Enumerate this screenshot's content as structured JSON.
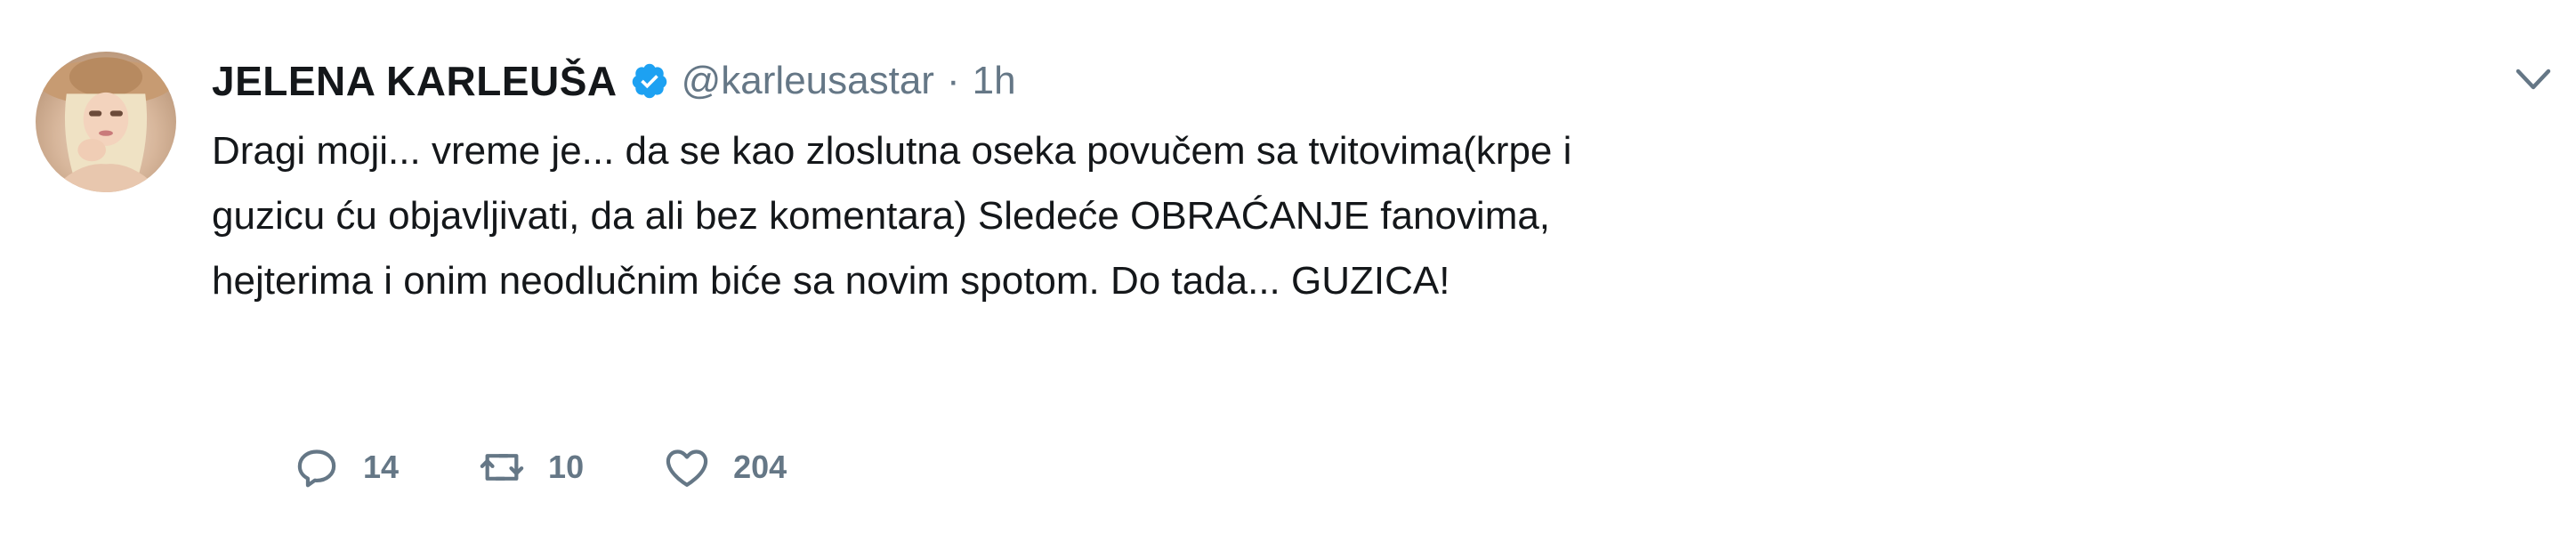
{
  "tweet": {
    "display_name": "JELENA KARLEUŠA",
    "handle": "@karleusastar",
    "separator": "·",
    "time": "1h",
    "text_lines": [
      "Dragi moji... vreme je... da se kao zloslutna oseka povučem sa tvitovima(krpe i",
      "guzicu ću objavljivati, da ali bez komentara) Sledeće OBRAĆANJE fanovima,",
      "hejterima i onim neodlučnim biće sa novim spotom. Do tada... GUZICA!"
    ],
    "actions": {
      "reply_icon": "reply-icon",
      "reply_count": "14",
      "retweet_icon": "retweet-icon",
      "retweet_count": "10",
      "like_icon": "like-icon",
      "like_count": "204"
    }
  },
  "colors": {
    "text": "#14171a",
    "secondary": "#657786",
    "verified": "#1da1f2",
    "background": "#ffffff"
  }
}
